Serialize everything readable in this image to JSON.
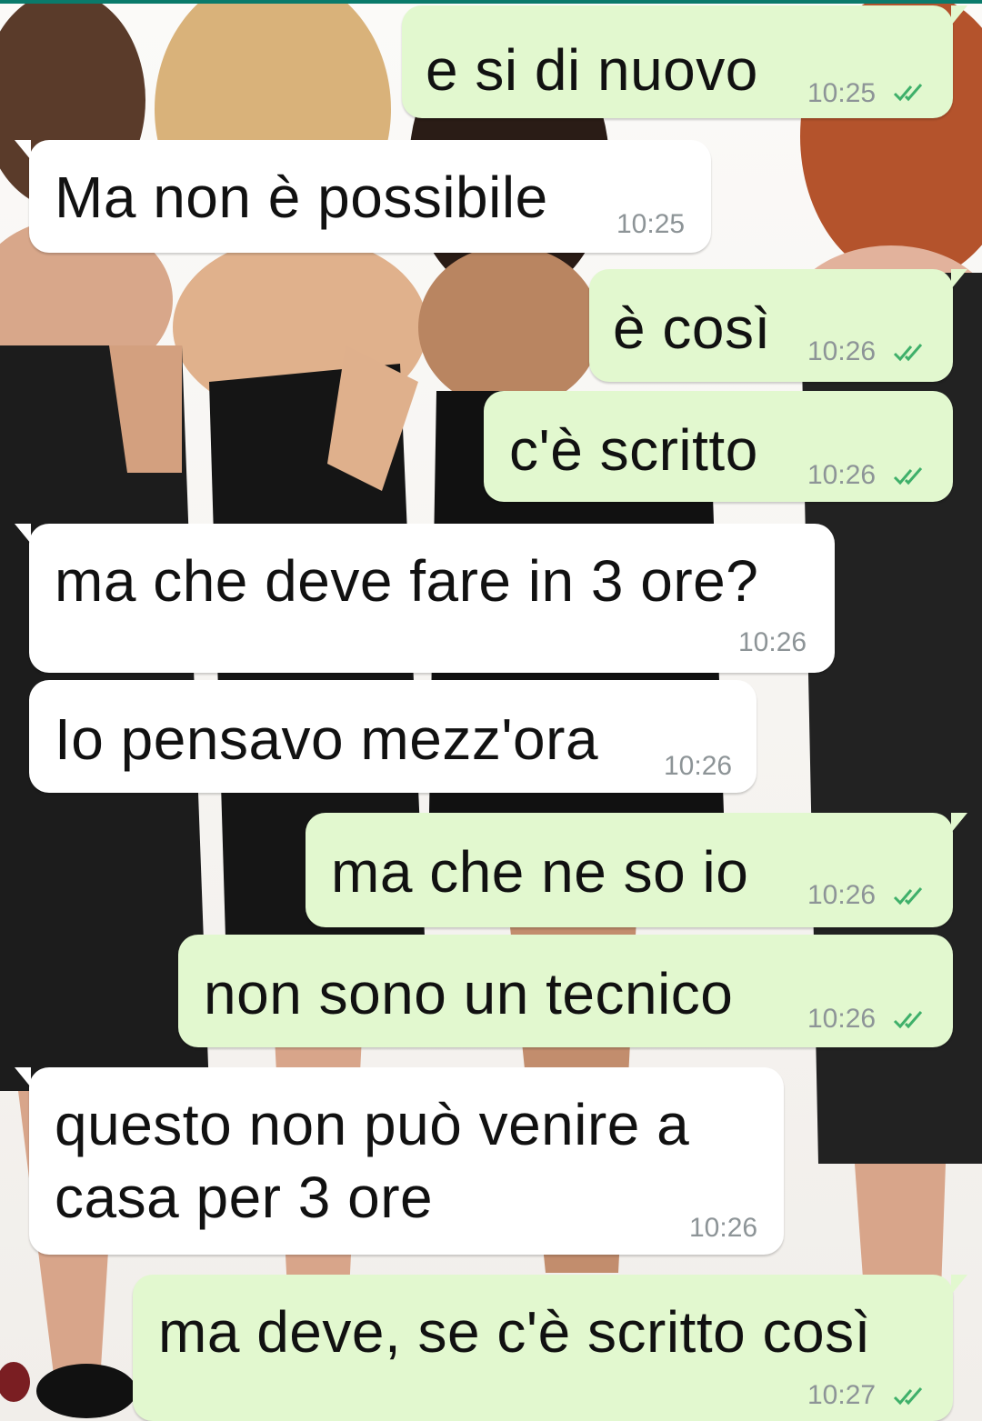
{
  "colors": {
    "outgoing_bubble": "#e2f8cf",
    "incoming_bubble": "#ffffff",
    "timestamp": "#8d9497",
    "read_ticks": "#3fb06a"
  },
  "messages": [
    {
      "direction": "outgoing",
      "text": "e si di nuovo",
      "time": "10:25",
      "status_icon": "double-check-icon"
    },
    {
      "direction": "incoming",
      "text": "Ma non è possibile",
      "time": "10:25"
    },
    {
      "direction": "outgoing",
      "text": "è così",
      "time": "10:26",
      "status_icon": "double-check-icon"
    },
    {
      "direction": "outgoing",
      "text": "c'è scritto",
      "time": "10:26",
      "status_icon": "double-check-icon"
    },
    {
      "direction": "incoming",
      "text": "ma che deve fare in 3 ore?",
      "time": "10:26"
    },
    {
      "direction": "incoming",
      "text": "Io pensavo mezz'ora",
      "time": "10:26"
    },
    {
      "direction": "outgoing",
      "text": "ma che ne so io",
      "time": "10:26",
      "status_icon": "double-check-icon"
    },
    {
      "direction": "outgoing",
      "text": "non sono un tecnico",
      "time": "10:26",
      "status_icon": "double-check-icon"
    },
    {
      "direction": "incoming",
      "text_lines": [
        "questo non può venire a",
        "casa per 3 ore"
      ],
      "time": "10:26"
    },
    {
      "direction": "outgoing",
      "text": "ma deve, se c'è scritto così",
      "time": "10:27",
      "status_icon": "double-check-icon"
    }
  ]
}
